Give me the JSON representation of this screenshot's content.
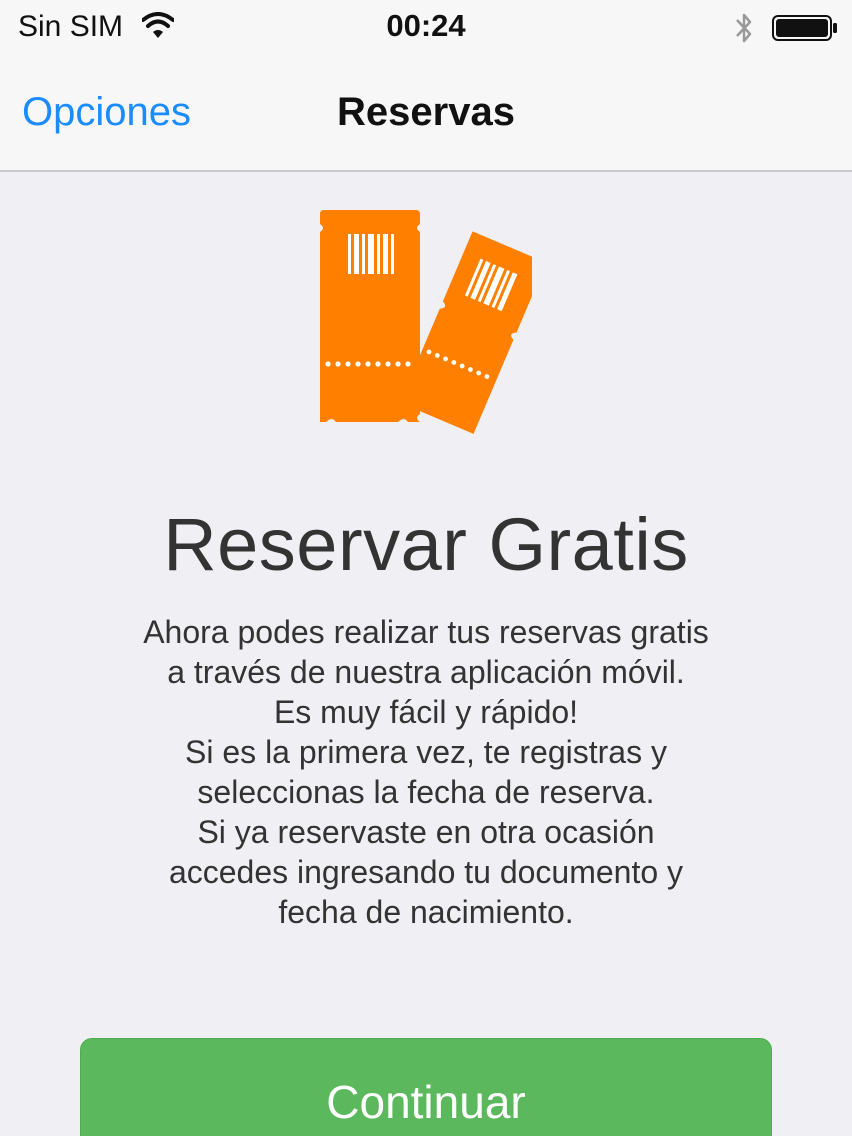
{
  "status_bar": {
    "carrier": "Sin SIM",
    "time": "00:24",
    "icons": [
      "wifi-icon",
      "bluetooth-icon",
      "battery-icon"
    ]
  },
  "nav": {
    "back_label": "Opciones",
    "title": "Reservas"
  },
  "main": {
    "icon": "tickets-icon",
    "headline": "Reservar Gratis",
    "description_lines": [
      "Ahora podes realizar tus reservas gratis",
      "a través de nuestra aplicación móvil.",
      "Es muy fácil y rápido!",
      "Si es la primera vez, te registras y",
      "seleccionas la fecha de reserva.",
      "Si ya reservaste en otra ocasión",
      "accedes ingresando tu documento y",
      "fecha de nacimiento."
    ],
    "continue_label": "Continuar"
  },
  "colors": {
    "accent_blue": "#1a8cff",
    "ticket_orange": "#ff8000",
    "button_green": "#5cb85c",
    "background": "#efeff4"
  }
}
